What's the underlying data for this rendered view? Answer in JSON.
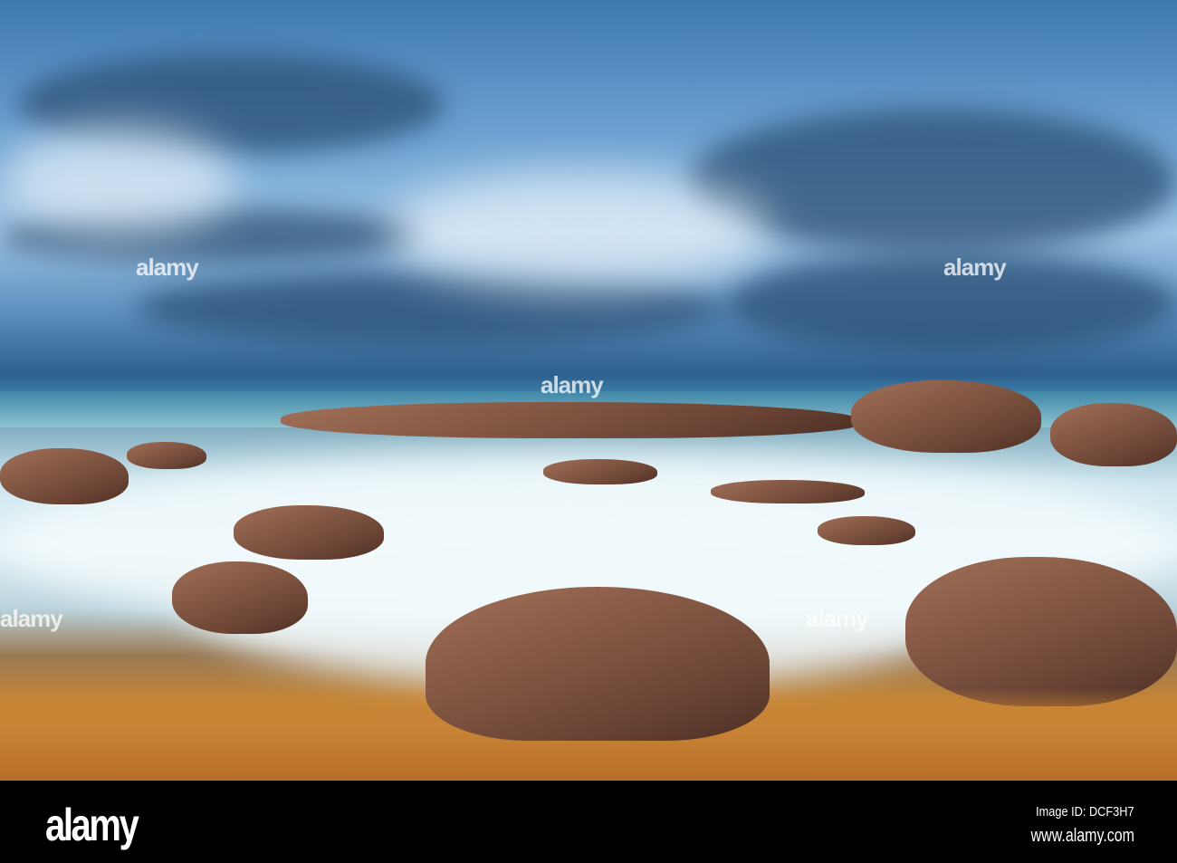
{
  "photo": {
    "subject": "rocky seashore",
    "watermark": "alamy",
    "colors": {
      "sky": "#5d8fbf",
      "foam": "#e4f2f7",
      "rock": "#6d4636",
      "sand": "#c58534"
    }
  },
  "footer": {
    "logo": "alamy",
    "image_id": "Image ID: DCF3H7",
    "url": "www.alamy.com"
  }
}
